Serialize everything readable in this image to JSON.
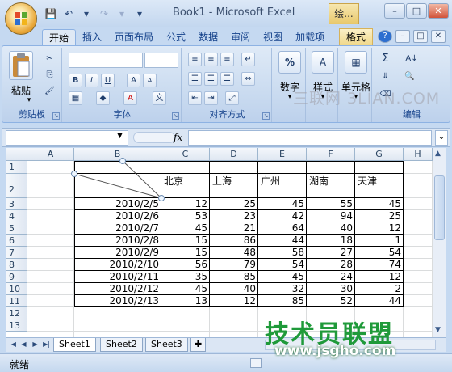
{
  "window": {
    "title": "Book1 - Microsoft Excel",
    "context_tab": "绘...",
    "min": "–",
    "restore": "□",
    "close": "✕"
  },
  "qat": {
    "save": "💾",
    "undo": "↶",
    "redo": "↷",
    "customize": "▾"
  },
  "ribbon_tabs": [
    "开始",
    "插入",
    "页面布局",
    "公式",
    "数据",
    "审阅",
    "视图",
    "加载项"
  ],
  "format_tab": "格式",
  "help": {
    "help": "?",
    "min": "–",
    "restore": "□",
    "close": "✕"
  },
  "ribbon": {
    "clipboard": {
      "paste": "粘贴",
      "label": "剪贴板"
    },
    "font": {
      "label": "字体",
      "bold": "B",
      "italic": "I",
      "underline": "U",
      "grow": "A",
      "shrink": "A",
      "color": "A",
      "phonetic": "文"
    },
    "alignment": {
      "label": "对齐方式"
    },
    "number": {
      "label": "数字",
      "symbol": "%"
    },
    "styles": {
      "label": "样式"
    },
    "cells": {
      "label": "单元格"
    },
    "editing": {
      "label": "编辑",
      "sum": "Σ",
      "sort": "A↓",
      "find": "🔍"
    },
    "watermark": "三联网 3LIAN.COM"
  },
  "formula_bar": {
    "namebox": "",
    "fx": "fx",
    "formula": "",
    "expand": "⌄"
  },
  "columns": [
    "A",
    "B",
    "C",
    "D",
    "E",
    "F",
    "G",
    "H"
  ],
  "rows": [
    "1",
    "2",
    "3",
    "4",
    "5",
    "6",
    "7",
    "8",
    "9",
    "10",
    "11",
    "12",
    "13"
  ],
  "table": {
    "headers": [
      "北京",
      "上海",
      "广州",
      "湖南",
      "天津"
    ],
    "rows": [
      {
        "date": "2010/2/5",
        "vals": [
          "12",
          "25",
          "45",
          "55",
          "45"
        ]
      },
      {
        "date": "2010/2/6",
        "vals": [
          "53",
          "23",
          "42",
          "94",
          "25"
        ]
      },
      {
        "date": "2010/2/7",
        "vals": [
          "45",
          "21",
          "64",
          "40",
          "12"
        ]
      },
      {
        "date": "2010/2/8",
        "vals": [
          "15",
          "86",
          "44",
          "18",
          "1"
        ]
      },
      {
        "date": "2010/2/9",
        "vals": [
          "15",
          "48",
          "58",
          "27",
          "54"
        ]
      },
      {
        "date": "2010/2/10",
        "vals": [
          "56",
          "79",
          "54",
          "28",
          "74"
        ]
      },
      {
        "date": "2010/2/11",
        "vals": [
          "35",
          "85",
          "45",
          "24",
          "12"
        ]
      },
      {
        "date": "2010/2/12",
        "vals": [
          "45",
          "40",
          "32",
          "30",
          "2"
        ]
      },
      {
        "date": "2010/2/13",
        "vals": [
          "13",
          "12",
          "85",
          "52",
          "44"
        ]
      }
    ]
  },
  "sheets": [
    "Sheet1",
    "Sheet2",
    "Sheet3"
  ],
  "sheet_nav": [
    "|◀",
    "◀",
    "▶",
    "▶|"
  ],
  "status": {
    "ready": "就绪"
  },
  "brand": {
    "name": "技术员联盟",
    "url": "www.jsgho.com"
  }
}
